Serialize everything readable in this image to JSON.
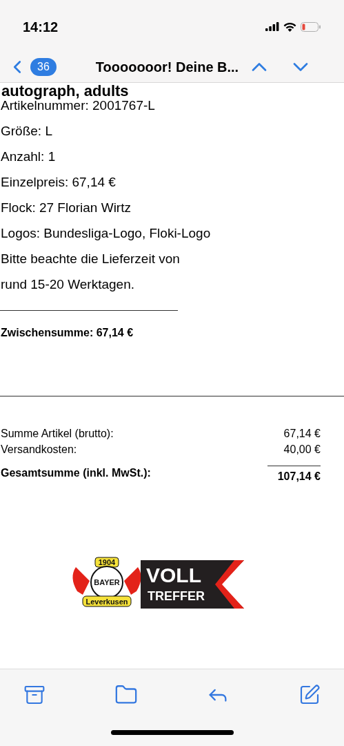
{
  "status_bar": {
    "time": "14:12"
  },
  "nav": {
    "unread_count": "36",
    "title": "Tooooooor! Deine B..."
  },
  "cut_heading": "autograph, adults",
  "item_lines": [
    "Artikelnummer: 2001767-L",
    "Größe: L",
    "Anzahl: 1",
    "Einzelpreis: 67,14 €",
    "Flock: 27 Florian Wirtz",
    "Logos: Bundesliga-Logo, Floki-Logo",
    "Bitte beachte die Lieferzeit von",
    "rund 15-20 Werktagen."
  ],
  "subtotal": "Zwischensumme: 67,14 €",
  "summary": [
    {
      "label": "Summe Artikel (brutto):",
      "value": "67,14 €",
      "kind": "plain"
    },
    {
      "label": "Versandkosten:",
      "value": "40,00 €",
      "kind": "plain"
    },
    {
      "label": "Gesamtsumme (inkl. MwSt.):",
      "value": "107,14 €",
      "kind": "total"
    }
  ],
  "logo": {
    "year": "1904",
    "club": "BAYER",
    "city": "Leverkusen",
    "slogan_top": "VOLL",
    "slogan_bottom": "TREFFER"
  }
}
